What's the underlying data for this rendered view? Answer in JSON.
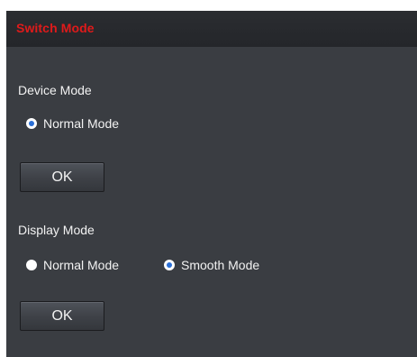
{
  "window": {
    "title": "Switch Mode"
  },
  "device_mode": {
    "label": "Device Mode",
    "options": [
      {
        "label": "Normal Mode",
        "selected": true
      }
    ],
    "ok_label": "OK"
  },
  "display_mode": {
    "label": "Display Mode",
    "options": [
      {
        "label": "Normal Mode",
        "selected": false
      },
      {
        "label": "Smooth Mode",
        "selected": true
      }
    ],
    "ok_label": "OK"
  },
  "colors": {
    "title": "#e01a1a",
    "panel_bg": "#3a3d42",
    "title_bar_bg": "#26282c",
    "radio_selected": "#2a6fd6"
  }
}
